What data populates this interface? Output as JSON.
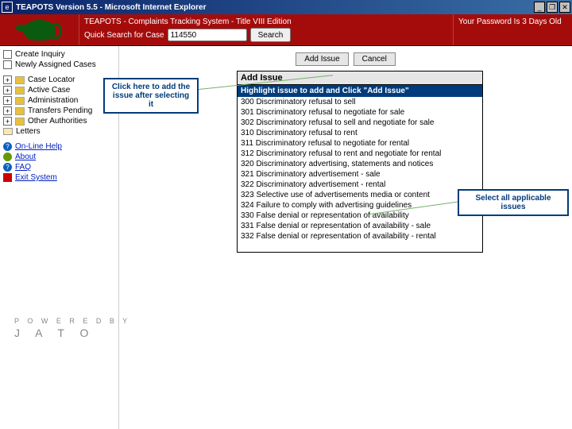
{
  "window": {
    "title": "TEAPOTS Version 5.5 - Microsoft Internet Explorer"
  },
  "banner": {
    "title": "TEAPOTS - Complaints Tracking System - Title VIII Edition",
    "quick_search_label": "Quick Search for Case",
    "search_value": "114550",
    "search_button": "Search",
    "password_notice": "Your Password Is 3 Days Old"
  },
  "sidebar": {
    "top": [
      {
        "label": "Create Inquiry"
      },
      {
        "label": "Newly Assigned Cases"
      }
    ],
    "tree": [
      {
        "label": "Case Locator"
      },
      {
        "label": "Active Case"
      },
      {
        "label": "Administration"
      },
      {
        "label": "Transfers Pending"
      },
      {
        "label": "Other Authorities"
      },
      {
        "label": "Letters"
      }
    ],
    "links": [
      {
        "label": "On-Line Help"
      },
      {
        "label": "About"
      },
      {
        "label": "FAQ"
      },
      {
        "label": "Exit System"
      }
    ]
  },
  "buttons": {
    "add_issue": "Add Issue",
    "cancel": "Cancel"
  },
  "panel": {
    "title": "Add Issue",
    "subtitle": "Highlight issue to add and Click \"Add Issue\"",
    "items": [
      "300 Discriminatory refusal to sell",
      "301 Discriminatory refusal to negotiate for sale",
      "302 Discriminatory refusal to sell and negotiate for sale",
      "310 Discriminatory refusal to rent",
      "311 Discriminatory refusal to negotiate for rental",
      "312 Discriminatory refusal to rent and negotiate for rental",
      "320 Discriminatory advertising, statements and notices",
      "321 Discriminatory advertisement - sale",
      "322 Discriminatory advertisement - rental",
      "323 Selective use of advertisements media or content",
      "324 Failure to comply with advertising guidelines",
      "330 False denial or representation of availability",
      "331 False denial or representation of availability - sale",
      "332 False denial or representation of availability - rental"
    ]
  },
  "callouts": {
    "c1": "Click here to add the issue after selecting it",
    "c2": "Select all applicable issues"
  },
  "powered": {
    "line1": "P O W E R E D  B Y",
    "line2": "J  A  T  O"
  }
}
